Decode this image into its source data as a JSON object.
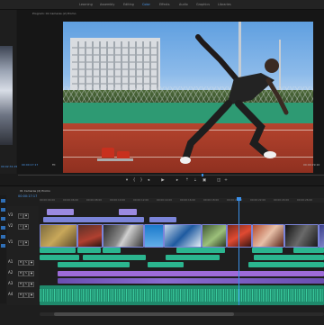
{
  "workspaces": {
    "items": [
      {
        "label": "Learning"
      },
      {
        "label": "Assembly"
      },
      {
        "label": "Editing"
      },
      {
        "label": "Color"
      },
      {
        "label": "Effects"
      },
      {
        "label": "Audio"
      },
      {
        "label": "Graphics"
      },
      {
        "label": "Libraries"
      }
    ]
  },
  "source_monitor": {
    "timecode": "00:02:31:15"
  },
  "program_monitor": {
    "title": "Program: 01 Cameras (2) Promo",
    "timecode": "00:00:17:17",
    "fit_label": "Fit",
    "duration": "00:00:29:10",
    "image_label": "sprinter-at-starting-blocks"
  },
  "timeline": {
    "tab_label": "01 Cameras (2) Promo",
    "timecode": "00:00:17:17",
    "ruler_ticks": [
      "00:00:04:00",
      "00:00:06:00",
      "00:00:08:00",
      "00:00:10:00",
      "00:00:12:00",
      "00:00:14:00",
      "00:00:16:00",
      "00:00:18:00",
      "00:00:20:00",
      "00:00:22:00",
      "00:00:24:00",
      "00:00:26:00"
    ],
    "tracks": [
      {
        "name": "V3"
      },
      {
        "name": "V2"
      },
      {
        "name": "V1"
      },
      {
        "name": "A1"
      },
      {
        "name": "A2"
      },
      {
        "name": "A3"
      },
      {
        "name": "A4"
      }
    ]
  },
  "colors": {
    "accent": "#4d9bf0",
    "label_video": "#7b84d9",
    "label_audio": "#2bb58f",
    "label_music": "#9d6bd8",
    "playhead": "#3a8fe8"
  },
  "icons": [
    "wrench-icon",
    "play-icon",
    "step-back-icon",
    "step-forward-icon",
    "marker-icon",
    "export-frame-icon",
    "lock-icon",
    "eye-icon",
    "mute-icon",
    "solo-icon",
    "mic-icon"
  ]
}
